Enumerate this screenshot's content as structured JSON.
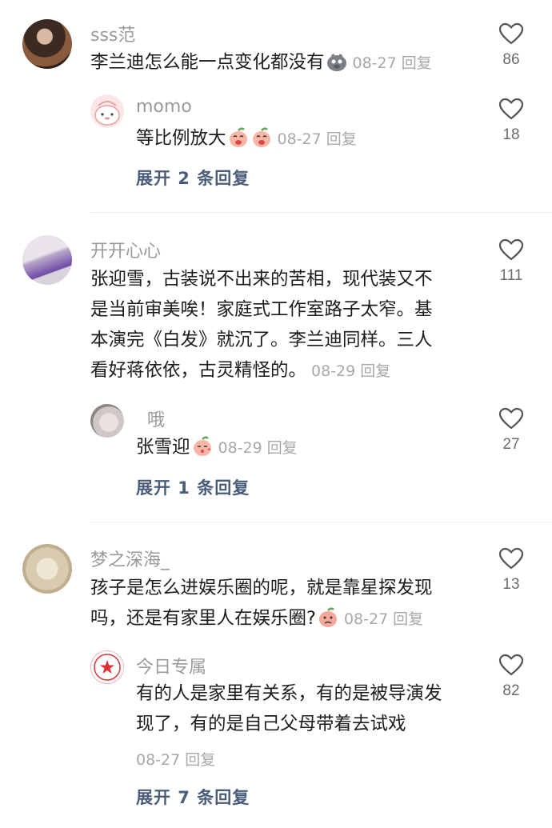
{
  "comments": [
    {
      "username": "sss范",
      "text": "李兰迪怎么能一点变化都没有",
      "emoji": "sad-pig-emoji",
      "date": "08-27",
      "reply_label": "回复",
      "likes": "86",
      "reply": {
        "username": "momo",
        "text": "等比例放大",
        "emoji": "laughing-peach-emoji",
        "date": "08-27",
        "reply_label": "回复",
        "likes": "18"
      },
      "expand_label": "展开 2 条回复"
    },
    {
      "username": "开开心心",
      "text_lines": [
        "张迎雪，古装说不出来的苦相，现代装又不",
        "是当前审美唉！家庭式工作室路子太窄。基",
        "本演完《白发》就沉了。李兰迪同样。三人",
        "看好蒋依依，古灵精怪的。"
      ],
      "date": "08-29",
      "reply_label": "回复",
      "likes": "111",
      "reply": {
        "username": "哦",
        "text": "张雪迎",
        "emoji": "kissing-peach-emoji",
        "date": "08-29",
        "reply_label": "回复",
        "likes": "27"
      },
      "expand_label": "展开 1 条回复"
    },
    {
      "username": "梦之深海_",
      "text_lines": [
        "孩子是怎么进娱乐圈的呢，就是靠星探发现",
        "吗，还是有家里人在娱乐圈?"
      ],
      "emoji": "confused-peach-emoji",
      "date": "08-27",
      "reply_label": "回复",
      "likes": "13",
      "reply": {
        "username": "今日专属",
        "text_lines": [
          "有的人是家里有关系，有的是被导演发",
          "现了，有的是自己父母带着去试戏"
        ],
        "date": "08-27",
        "reply_label": "回复",
        "likes": "82"
      },
      "expand_label": "展开 7 条回复"
    }
  ],
  "icons": {
    "like": "heart-outline-icon"
  },
  "colors": {
    "username": "#9a9a9a",
    "meta": "#a8a8a8",
    "expand": "#4a5d78"
  }
}
